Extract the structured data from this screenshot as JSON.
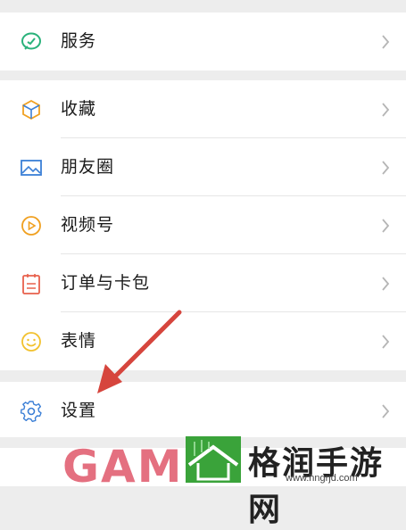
{
  "menu": {
    "group1": [
      {
        "label": "服务",
        "icon": "service-icon"
      }
    ],
    "group2": [
      {
        "label": "收藏",
        "icon": "favorites-cube-icon"
      },
      {
        "label": "朋友圈",
        "icon": "moments-image-icon"
      },
      {
        "label": "视频号",
        "icon": "channels-play-icon"
      },
      {
        "label": "订单与卡包",
        "icon": "orders-cards-icon"
      },
      {
        "label": "表情",
        "icon": "sticker-smile-icon"
      }
    ],
    "group3": [
      {
        "label": "设置",
        "icon": "settings-gear-icon"
      }
    ]
  },
  "watermark": {
    "text": "GAM",
    "site_name": "格润手游网",
    "url": "www.hngrjd.com"
  },
  "colors": {
    "service": "#2ab27b",
    "favorites": "#f0a020",
    "moments": "#3b7fd6",
    "channels": "#f0a020",
    "orders": "#e8604c",
    "sticker": "#f2c12e",
    "settings": "#3b7fd6",
    "arrow": "#d6453d"
  }
}
